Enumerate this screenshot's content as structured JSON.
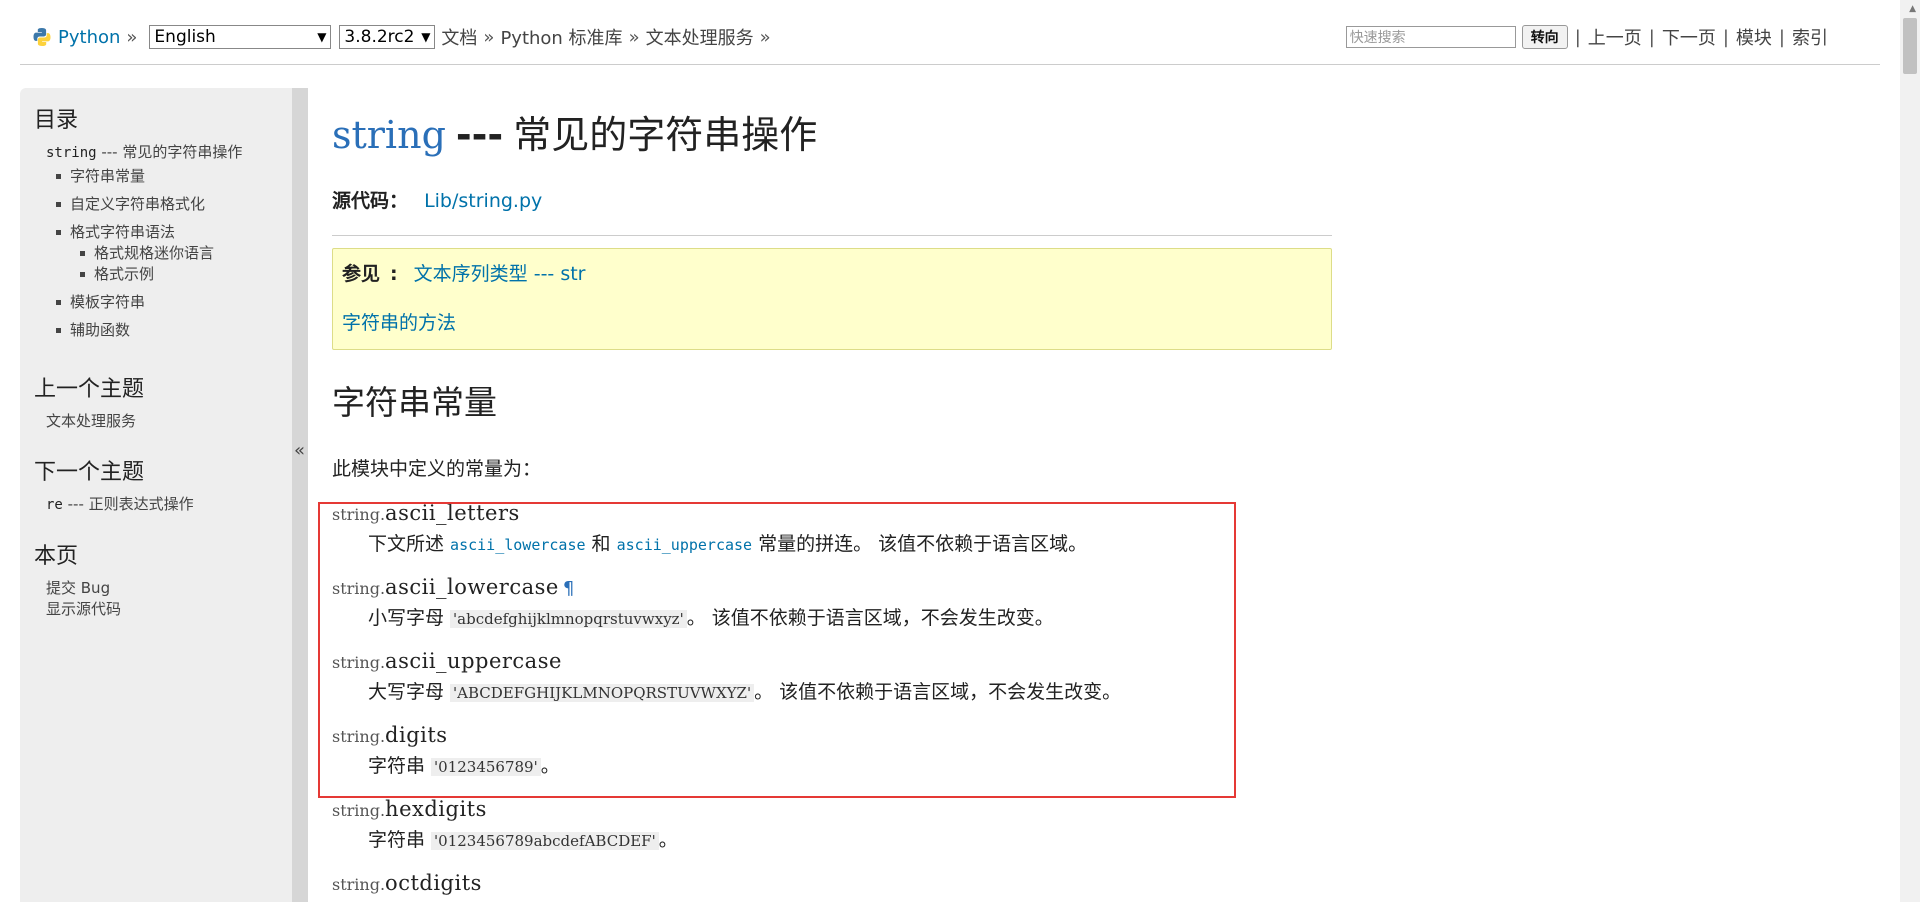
{
  "topbar": {
    "home": "Python",
    "lang_select": "English",
    "version_select": "3.8.2rc2",
    "crumbs": [
      "文档",
      "Python 标准库",
      "文本处理服务"
    ],
    "search_placeholder": "快速搜索",
    "go_label": "转向",
    "nav": [
      "上一页",
      "下一页",
      "模块",
      "索引"
    ]
  },
  "sidebar": {
    "toc_title": "目录",
    "toc_root_code": "string",
    "toc_root_text": " --- 常见的字符串操作",
    "toc_items": [
      "字符串常量",
      "自定义字符串格式化",
      "格式字符串语法"
    ],
    "toc_sub_items": [
      "格式规格迷你语言",
      "格式示例"
    ],
    "toc_items_after": [
      "模板字符串",
      "辅助函数"
    ],
    "prev_title": "上一个主题",
    "prev_link": "文本处理服务",
    "next_title": "下一个主题",
    "next_code": "re",
    "next_text": " --- 正则表达式操作",
    "this_page_title": "本页",
    "this_page_links": [
      "提交 Bug",
      "显示源代码"
    ],
    "collapse": "«"
  },
  "main": {
    "title_code": "string",
    "title_sep": "---",
    "title_text": "常见的字符串操作",
    "source_label": "源代码：",
    "source_link": "Lib/string.py",
    "seealso_label": "参见",
    "seealso_link1": "文本序列类型 --- str",
    "seealso_link2": "字符串的方法",
    "section_title": "字符串常量",
    "intro": "此模块中定义的常量为：",
    "defs": [
      {
        "prefix": "string.",
        "name": "ascii_letters",
        "desc_a": "下文所述 ",
        "xref1": "ascii_lowercase",
        "desc_b": " 和 ",
        "xref2": "ascii_uppercase",
        "desc_c": " 常量的拼连。 该值不依赖于语言区域。"
      },
      {
        "prefix": "string.",
        "name": "ascii_lowercase",
        "pilcrow": "¶",
        "desc_a": "小写字母 ",
        "lit": "'abcdefghijklmnopqrstuvwxyz'",
        "desc_b": "。 该值不依赖于语言区域，不会发生改变。"
      },
      {
        "prefix": "string.",
        "name": "ascii_uppercase",
        "desc_a": "大写字母 ",
        "lit": "'ABCDEFGHIJKLMNOPQRSTUVWXYZ'",
        "desc_b": "。 该值不依赖于语言区域，不会发生改变。"
      },
      {
        "prefix": "string.",
        "name": "digits",
        "desc_a": "字符串 ",
        "lit": "'0123456789'",
        "desc_b": "。"
      },
      {
        "prefix": "string.",
        "name": "hexdigits",
        "desc_a": "字符串 ",
        "lit": "'0123456789abcdefABCDEF'",
        "desc_b": "。"
      },
      {
        "prefix": "string.",
        "name": "octdigits"
      }
    ]
  }
}
